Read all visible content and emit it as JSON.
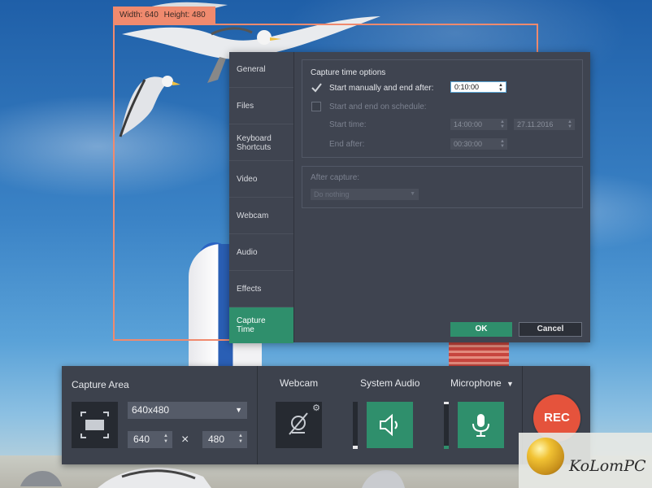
{
  "capture_frame": {
    "width_label": "Width: 640",
    "height_label": "Height: 480",
    "frame_color": "#f08a6e"
  },
  "settings": {
    "nav": [
      {
        "label": "General"
      },
      {
        "label": "Files"
      },
      {
        "label": "Keyboard Shortcuts"
      },
      {
        "label": "Video"
      },
      {
        "label": "Webcam"
      },
      {
        "label": "Audio"
      },
      {
        "label": "Effects"
      },
      {
        "label": "Capture Time",
        "active": true
      }
    ],
    "capture_time_options": {
      "title": "Capture time options",
      "manual_label": "Start manually and end after:",
      "manual_checked": true,
      "manual_value": "0:10:00",
      "schedule_label": "Start and end on schedule:",
      "schedule_checked": false,
      "start_time_label": "Start time:",
      "start_time_value": "14:00:00",
      "start_date_value": "27.11.2016",
      "end_after_label": "End after:",
      "end_after_value": "00:30:00"
    },
    "after_capture": {
      "title": "After capture:",
      "value": "Do nothing"
    },
    "ok_label": "OK",
    "cancel_label": "Cancel",
    "accent_color": "#2f8f6c"
  },
  "toolbar": {
    "capture_area_title": "Capture Area",
    "resolution": "640x480",
    "width": "640",
    "height": "480",
    "times_sign": "×",
    "webcam_title": "Webcam",
    "system_audio_title": "System Audio",
    "microphone_title": "Microphone",
    "microphone_dropdown": "▼",
    "rec_label": "REC",
    "rec_color": "#e5533c",
    "icons": {
      "capture_area": "capture-area-icon",
      "webcam": "webcam-off-icon",
      "webcam_settings": "gear-icon",
      "system_audio": "speaker-icon",
      "microphone": "microphone-icon"
    }
  },
  "watermark": {
    "text": "KoLomPC"
  }
}
